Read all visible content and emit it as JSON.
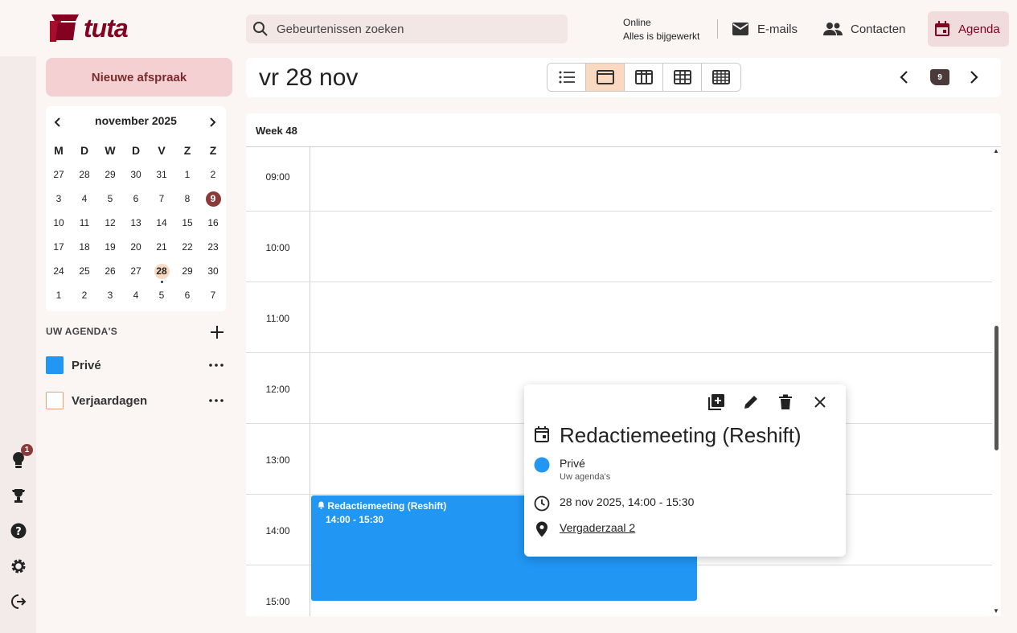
{
  "app": {
    "logo_text": "tuta"
  },
  "search": {
    "placeholder": "Gebeurtenissen zoeken"
  },
  "status": {
    "line1": "Online",
    "line2": "Alles is bijgewerkt"
  },
  "nav": {
    "emails": "E-mails",
    "contacts": "Contacten",
    "agenda": "Agenda"
  },
  "sidebar": {
    "new_button": "Nieuwe afspraak",
    "mini_calendar": {
      "title": "november 2025",
      "weekdays": [
        "M",
        "D",
        "W",
        "D",
        "V",
        "Z",
        "Z"
      ],
      "weeks": [
        [
          "27",
          "28",
          "29",
          "30",
          "31",
          "1",
          "2"
        ],
        [
          "3",
          "4",
          "5",
          "6",
          "7",
          "8",
          "9"
        ],
        [
          "10",
          "11",
          "12",
          "13",
          "14",
          "15",
          "16"
        ],
        [
          "17",
          "18",
          "19",
          "20",
          "21",
          "22",
          "23"
        ],
        [
          "24",
          "25",
          "26",
          "27",
          "28",
          "29",
          "30"
        ],
        [
          "1",
          "2",
          "3",
          "4",
          "5",
          "6",
          "7"
        ]
      ],
      "today": "9",
      "selected": "28"
    },
    "agendas_heading": "UW AGENDA'S",
    "agendas": [
      {
        "label": "Privé",
        "color": "#2196f3",
        "filled": true
      },
      {
        "label": "Verjaardagen",
        "color": "#f0a070",
        "filled": false
      }
    ],
    "rail_badge": "1"
  },
  "main": {
    "date_title": "vr 28 nov",
    "today_number": "9",
    "week_label": "Week 48",
    "hours": [
      "09:00",
      "10:00",
      "11:00",
      "12:00",
      "13:00",
      "14:00",
      "15:00"
    ]
  },
  "event": {
    "title": "Redactiemeeting (Reshift)",
    "time": "14:00 - 15:30",
    "color": "#2196f3"
  },
  "popup": {
    "title": "Redactiemeeting (Reshift)",
    "calendar_name": "Privé",
    "calendar_group": "Uw agenda's",
    "datetime": "28 nov 2025, 14:00 - 15:30",
    "location": "Vergaderzaal 2"
  }
}
